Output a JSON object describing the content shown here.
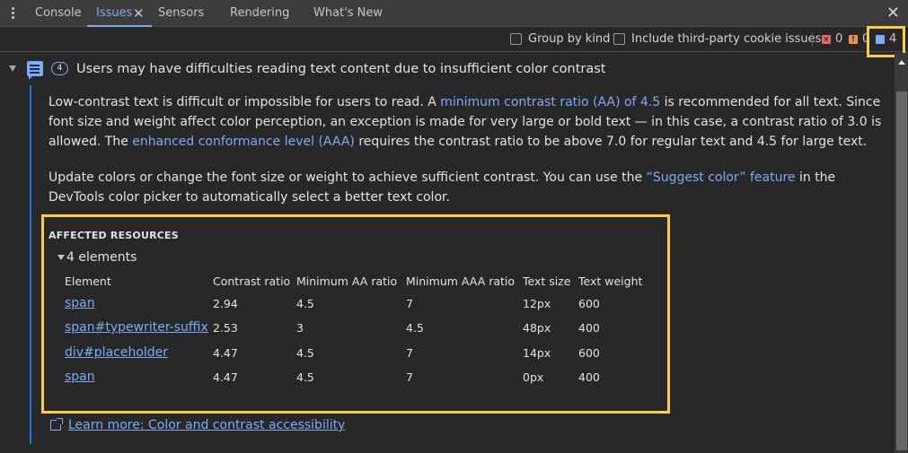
{
  "tabbar": {
    "tabs": [
      {
        "label": "Console",
        "active": false
      },
      {
        "label": "Issues",
        "active": true,
        "closable": true
      },
      {
        "label": "Sensors",
        "active": false
      },
      {
        "label": "Rendering",
        "active": false
      },
      {
        "label": "What's New",
        "active": false
      }
    ],
    "tab_close_glyph": "✕",
    "panel_close_glyph": "✕"
  },
  "toolbar": {
    "group_by_kind": {
      "label": "Group by kind",
      "checked": false
    },
    "third_party": {
      "label": "Include third-party cookie issues",
      "checked": false
    },
    "counts": {
      "errors": "0",
      "warnings": "0",
      "issues": "4"
    },
    "colors": {
      "error": "#e46962",
      "warning": "#f28b54",
      "info": "#7cacf8",
      "highlight": "#ffcb45"
    }
  },
  "issue": {
    "count_badge": "4",
    "title": "Users may have difficulties reading text content due to insufficient color contrast",
    "para1": {
      "t1": "Low-contrast text is difficult or impossible for users to read. A ",
      "link1": "minimum contrast ratio (AA) of 4.5",
      "t2": " is recommended for all text. Since font size and weight affect color perception, an exception is made for very large or bold text — in this case, a contrast ratio of 3.0 is allowed. The ",
      "link2": "enhanced conformance level (AAA)",
      "t3": " requires the contrast ratio to be above 7.0 for regular text and 4.5 for large text."
    },
    "para2": {
      "t1": "Update colors or change the font size or weight to achieve sufficient contrast. You can use the ",
      "link1": "“Suggest color” feature",
      "t2": " in the DevTools color picker to automatically select a better text color."
    },
    "affected": {
      "title": "AFFECTED RESOURCES",
      "toggle_label": "4 elements",
      "columns": [
        "Element",
        "Contrast ratio",
        "Minimum AA ratio",
        "Minimum AAA ratio",
        "Text size",
        "Text weight"
      ],
      "rows": [
        [
          "span",
          "2.94",
          "4.5",
          "7",
          "12px",
          "600"
        ],
        [
          "span#typewriter-suffix",
          "2.53",
          "3",
          "4.5",
          "48px",
          "400"
        ],
        [
          "div#placeholder",
          "4.47",
          "4.5",
          "7",
          "14px",
          "600"
        ],
        [
          "span",
          "4.47",
          "4.5",
          "7",
          "0px",
          "400"
        ]
      ]
    },
    "learn_more": "Learn more: Color and contrast accessibility"
  }
}
